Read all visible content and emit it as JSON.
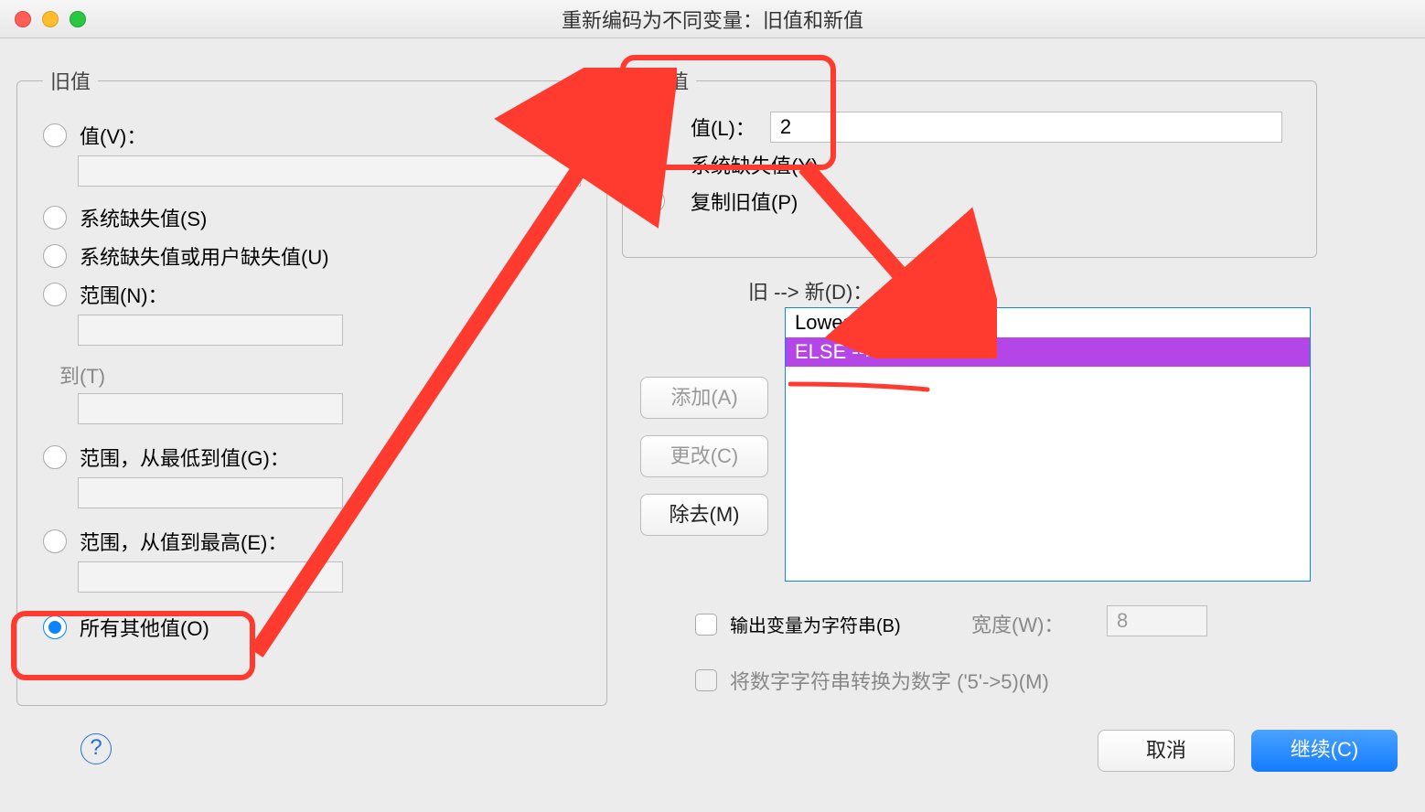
{
  "title": "重新编码为不同变量：旧值和新值",
  "oldValue": {
    "legend": "旧值",
    "optValue": "值(V)：",
    "valueInput": "",
    "optSysMissing": "系统缺失值(S)",
    "optSysUserMissing": "系统缺失值或用户缺失值(U)",
    "optRange": "范围(N)：",
    "rangeFrom": "",
    "rangeToLabel": "到(T)",
    "rangeTo": "",
    "optRangeLowest": "范围，从最低到值(G)：",
    "rangeLowestVal": "",
    "optRangeHighest": "范围，从值到最高(E)：",
    "rangeHighestVal": "",
    "optAllOther": "所有其他值(O)"
  },
  "newValue": {
    "legend": "新值",
    "optValue": "值(L)：",
    "valueInput": "2",
    "optSysMissing": "系统缺失值(Y)",
    "optCopyOld": "复制旧值(P)"
  },
  "mappings": {
    "label": "旧 --> 新(D)：",
    "items": [
      "Lowest thru 3.00 --> 1",
      "ELSE --> 2"
    ],
    "selectedIndex": 1,
    "add": "添加(A)",
    "change": "更改(C)",
    "remove": "除去(M)"
  },
  "output": {
    "cbString": "输出变量为字符串(B)",
    "widthLabel": "宽度(W)：",
    "widthValue": "8",
    "cbConvert": "将数字字符串转换为数字 ('5'->5)(M)"
  },
  "footer": {
    "help": "?",
    "cancel": "取消",
    "continue": "继续(C)"
  }
}
